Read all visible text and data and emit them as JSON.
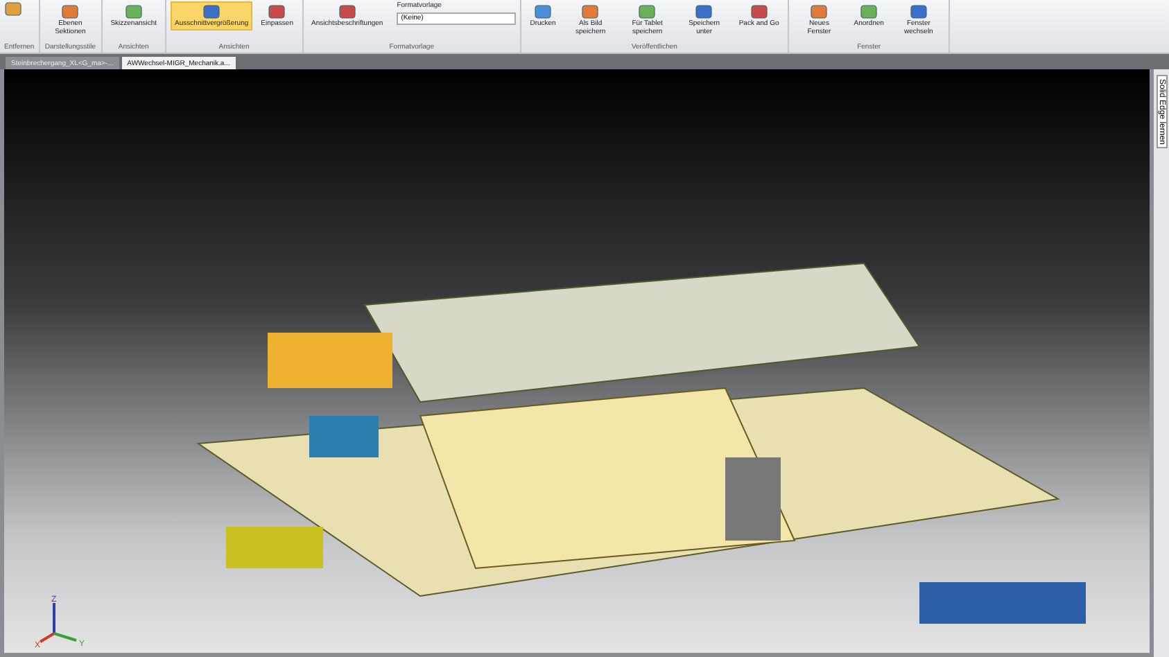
{
  "ribbon": {
    "groups": [
      {
        "label": "Entfernen"
      },
      {
        "label": "Darstellungsstile",
        "buttons": [
          {
            "label": "Ebenen Sektionen",
            "selected": false
          }
        ]
      },
      {
        "label": "Ansichten",
        "buttons": [
          {
            "label": "Skizzenansicht",
            "selected": false
          }
        ]
      },
      {
        "label": "Ansichten",
        "buttons": [
          {
            "label": "Ausschnittvergrößerung",
            "selected": true
          },
          {
            "label": "Einpassen",
            "selected": false
          }
        ]
      },
      {
        "label": "Formatvorlage",
        "buttons": [
          {
            "label": "Ansichtsbeschriftungen",
            "selected": false
          }
        ],
        "dropdown_label": "Formatvorlage",
        "dropdown_value": "(Keine)"
      },
      {
        "label": "Veröffentlichen",
        "buttons": [
          {
            "label": "Drucken",
            "selected": false
          },
          {
            "label": "Als Bild speichern",
            "selected": false
          },
          {
            "label": "Für Tablet speichern",
            "selected": false
          },
          {
            "label": "Speichern unter",
            "selected": false
          },
          {
            "label": "Pack and Go",
            "selected": false
          }
        ]
      },
      {
        "label": "Fenster",
        "buttons": [
          {
            "label": "Neues Fenster",
            "selected": false
          },
          {
            "label": "Anordnen",
            "selected": false
          },
          {
            "label": "Fenster wechseln",
            "selected": false
          }
        ]
      }
    ]
  },
  "document_tabs": [
    {
      "label": "Steinbrechergang_XL<G_ma>-...",
      "selected": false
    },
    {
      "label": "AWWechsel-MIGR_Mechanik.a...",
      "selected": true
    }
  ],
  "side_panel": {
    "label": "Solid Edge lernen"
  },
  "axes": {
    "x": "X",
    "y": "Y",
    "z": "Z"
  }
}
